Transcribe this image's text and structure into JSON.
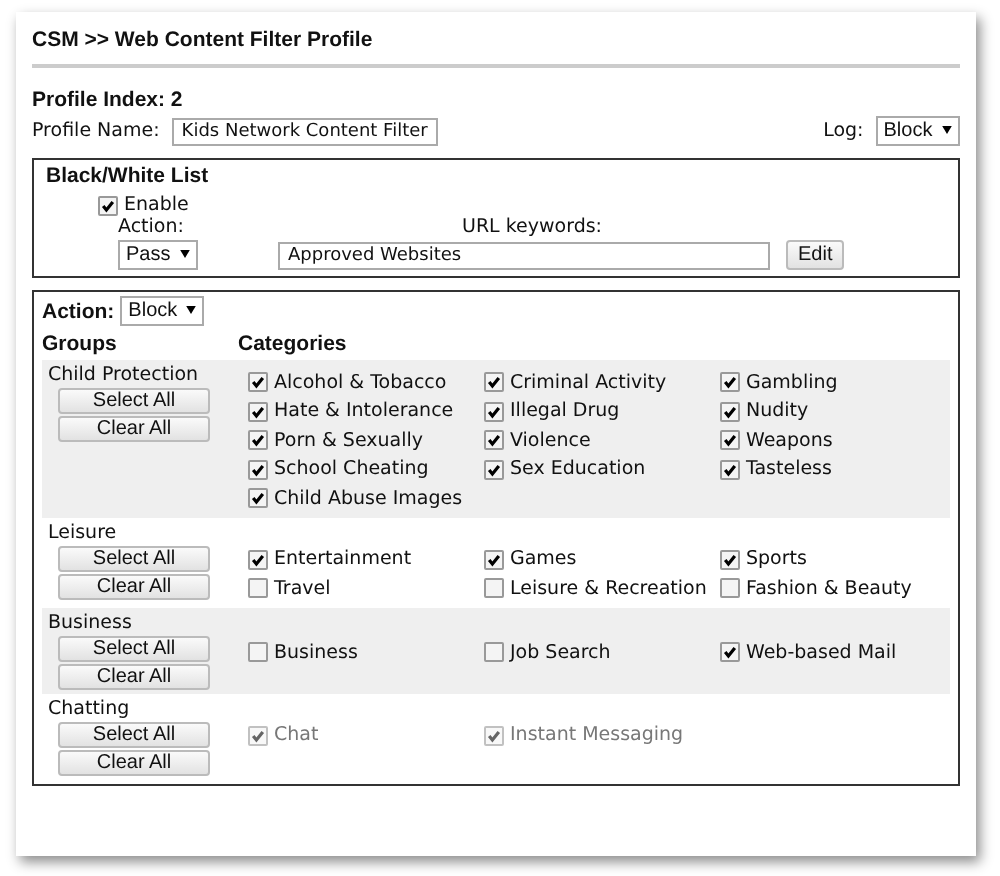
{
  "header": {
    "title": "CSM >> Web Content Filter Profile"
  },
  "profile": {
    "index_label": "Profile Index: 2",
    "name_label": "Profile Name:",
    "name_value": "Kids Network Content Filter",
    "log_label": "Log:",
    "log_value": "Block"
  },
  "black_white_list": {
    "title": "Black/White List",
    "enable_label": "Enable",
    "enable_checked": true,
    "action_label": "Action:",
    "action_value": "Pass",
    "keywords_label": "URL keywords:",
    "keywords_value": "Approved Websites",
    "edit_button": "Edit"
  },
  "filter": {
    "action_label": "Action:",
    "action_value": "Block",
    "groups_heading": "Groups",
    "categories_heading": "Categories",
    "groups": [
      {
        "name": "Child Protection",
        "select_all": "Select All",
        "clear_all": "Clear All",
        "categories": [
          {
            "label": "Alcohol & Tobacco",
            "checked": true,
            "disabled": false
          },
          {
            "label": "Criminal Activity",
            "checked": true,
            "disabled": false
          },
          {
            "label": "Gambling",
            "checked": true,
            "disabled": false
          },
          {
            "label": "Hate & Intolerance",
            "checked": true,
            "disabled": false
          },
          {
            "label": "Illegal Drug",
            "checked": true,
            "disabled": false
          },
          {
            "label": "Nudity",
            "checked": true,
            "disabled": false
          },
          {
            "label": "Porn & Sexually",
            "checked": true,
            "disabled": false
          },
          {
            "label": "Violence",
            "checked": true,
            "disabled": false
          },
          {
            "label": "Weapons",
            "checked": true,
            "disabled": false
          },
          {
            "label": "School Cheating",
            "checked": true,
            "disabled": false
          },
          {
            "label": "Sex Education",
            "checked": true,
            "disabled": false
          },
          {
            "label": "Tasteless",
            "checked": true,
            "disabled": false
          },
          {
            "label": "Child Abuse Images",
            "checked": true,
            "disabled": false
          }
        ]
      },
      {
        "name": "Leisure",
        "select_all": "Select All",
        "clear_all": "Clear All",
        "categories": [
          {
            "label": "Entertainment",
            "checked": true,
            "disabled": false
          },
          {
            "label": "Games",
            "checked": true,
            "disabled": false
          },
          {
            "label": "Sports",
            "checked": true,
            "disabled": false
          },
          {
            "label": "Travel",
            "checked": false,
            "disabled": false
          },
          {
            "label": "Leisure & Recreation",
            "checked": false,
            "disabled": false
          },
          {
            "label": "Fashion & Beauty",
            "checked": false,
            "disabled": false
          }
        ]
      },
      {
        "name": "Business",
        "select_all": "Select All",
        "clear_all": "Clear All",
        "categories": [
          {
            "label": "Business",
            "checked": false,
            "disabled": false
          },
          {
            "label": "Job Search",
            "checked": false,
            "disabled": false
          },
          {
            "label": "Web-based Mail",
            "checked": true,
            "disabled": false
          }
        ]
      },
      {
        "name": "Chatting",
        "select_all": "Select All",
        "clear_all": "Clear All",
        "categories": [
          {
            "label": "Chat",
            "checked": true,
            "disabled": true
          },
          {
            "label": "Instant Messaging",
            "checked": true,
            "disabled": true
          }
        ]
      }
    ]
  }
}
